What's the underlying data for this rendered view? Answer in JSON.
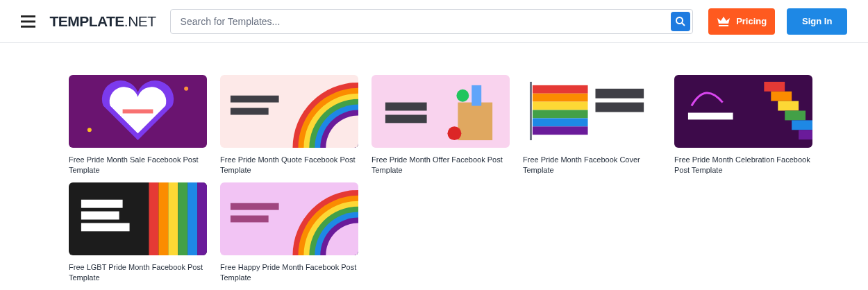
{
  "header": {
    "logo": "**TEMPLATE**.NET",
    "search": {
      "placeholder": "Search for Templates..."
    },
    "pricing_button": "Pricing",
    "sign_in_button": "Sign In"
  },
  "cards": [
    {
      "title": "Free Pride Month Sale Facebook Post Template"
    },
    {
      "title": "Free Pride Month Quote Facebook Post Template"
    },
    {
      "title": "Free Pride Month Offer Facebook Post Template"
    },
    {
      "title": "Free Pride Month Facebook Cover Template"
    },
    {
      "title": "Free Pride Month Celebration Facebook Post Template"
    },
    {
      "title": "Free LGBT Pride Month Facebook Post Template"
    },
    {
      "title": "Free Happy Pride Month Facebook Post Template"
    }
  ]
}
